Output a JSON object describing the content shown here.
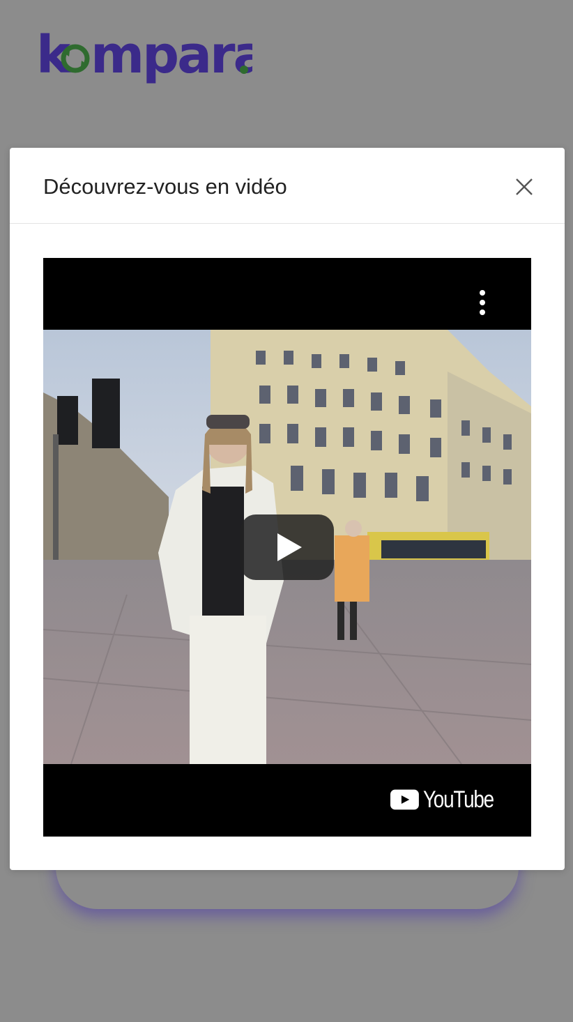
{
  "brand": {
    "logo_text": "kompara",
    "primary_color": "#3b2a8a",
    "accent_color": "#2f6b2f"
  },
  "modal": {
    "title": "Découvrez-vous en vidéo",
    "close_icon": "close-icon"
  },
  "video": {
    "provider_label": "YouTube",
    "play_icon": "play-icon",
    "menu_icon": "more-vertical-icon"
  },
  "overlay": {
    "color": "#8c8c8c"
  }
}
